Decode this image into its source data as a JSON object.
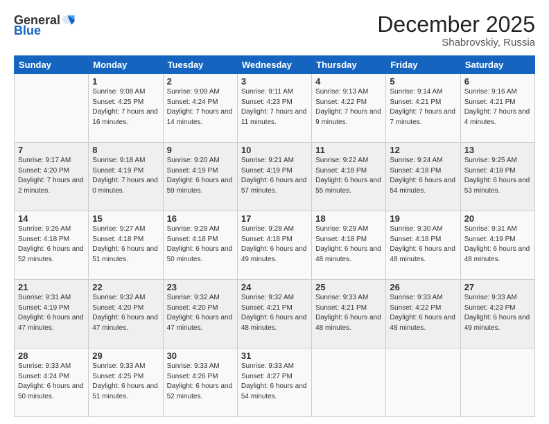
{
  "header": {
    "logo_general": "General",
    "logo_blue": "Blue",
    "month_title": "December 2025",
    "location": "Shabrovskiy, Russia"
  },
  "days_of_week": [
    "Sunday",
    "Monday",
    "Tuesday",
    "Wednesday",
    "Thursday",
    "Friday",
    "Saturday"
  ],
  "weeks": [
    [
      {
        "day": "",
        "sunrise": "",
        "sunset": "",
        "daylight": ""
      },
      {
        "day": "1",
        "sunrise": "Sunrise: 9:08 AM",
        "sunset": "Sunset: 4:25 PM",
        "daylight": "Daylight: 7 hours and 16 minutes."
      },
      {
        "day": "2",
        "sunrise": "Sunrise: 9:09 AM",
        "sunset": "Sunset: 4:24 PM",
        "daylight": "Daylight: 7 hours and 14 minutes."
      },
      {
        "day": "3",
        "sunrise": "Sunrise: 9:11 AM",
        "sunset": "Sunset: 4:23 PM",
        "daylight": "Daylight: 7 hours and 11 minutes."
      },
      {
        "day": "4",
        "sunrise": "Sunrise: 9:13 AM",
        "sunset": "Sunset: 4:22 PM",
        "daylight": "Daylight: 7 hours and 9 minutes."
      },
      {
        "day": "5",
        "sunrise": "Sunrise: 9:14 AM",
        "sunset": "Sunset: 4:21 PM",
        "daylight": "Daylight: 7 hours and 7 minutes."
      },
      {
        "day": "6",
        "sunrise": "Sunrise: 9:16 AM",
        "sunset": "Sunset: 4:21 PM",
        "daylight": "Daylight: 7 hours and 4 minutes."
      }
    ],
    [
      {
        "day": "7",
        "sunrise": "Sunrise: 9:17 AM",
        "sunset": "Sunset: 4:20 PM",
        "daylight": "Daylight: 7 hours and 2 minutes."
      },
      {
        "day": "8",
        "sunrise": "Sunrise: 9:18 AM",
        "sunset": "Sunset: 4:19 PM",
        "daylight": "Daylight: 7 hours and 0 minutes."
      },
      {
        "day": "9",
        "sunrise": "Sunrise: 9:20 AM",
        "sunset": "Sunset: 4:19 PM",
        "daylight": "Daylight: 6 hours and 59 minutes."
      },
      {
        "day": "10",
        "sunrise": "Sunrise: 9:21 AM",
        "sunset": "Sunset: 4:19 PM",
        "daylight": "Daylight: 6 hours and 57 minutes."
      },
      {
        "day": "11",
        "sunrise": "Sunrise: 9:22 AM",
        "sunset": "Sunset: 4:18 PM",
        "daylight": "Daylight: 6 hours and 55 minutes."
      },
      {
        "day": "12",
        "sunrise": "Sunrise: 9:24 AM",
        "sunset": "Sunset: 4:18 PM",
        "daylight": "Daylight: 6 hours and 54 minutes."
      },
      {
        "day": "13",
        "sunrise": "Sunrise: 9:25 AM",
        "sunset": "Sunset: 4:18 PM",
        "daylight": "Daylight: 6 hours and 53 minutes."
      }
    ],
    [
      {
        "day": "14",
        "sunrise": "Sunrise: 9:26 AM",
        "sunset": "Sunset: 4:18 PM",
        "daylight": "Daylight: 6 hours and 52 minutes."
      },
      {
        "day": "15",
        "sunrise": "Sunrise: 9:27 AM",
        "sunset": "Sunset: 4:18 PM",
        "daylight": "Daylight: 6 hours and 51 minutes."
      },
      {
        "day": "16",
        "sunrise": "Sunrise: 9:28 AM",
        "sunset": "Sunset: 4:18 PM",
        "daylight": "Daylight: 6 hours and 50 minutes."
      },
      {
        "day": "17",
        "sunrise": "Sunrise: 9:28 AM",
        "sunset": "Sunset: 4:18 PM",
        "daylight": "Daylight: 6 hours and 49 minutes."
      },
      {
        "day": "18",
        "sunrise": "Sunrise: 9:29 AM",
        "sunset": "Sunset: 4:18 PM",
        "daylight": "Daylight: 6 hours and 48 minutes."
      },
      {
        "day": "19",
        "sunrise": "Sunrise: 9:30 AM",
        "sunset": "Sunset: 4:18 PM",
        "daylight": "Daylight: 6 hours and 48 minutes."
      },
      {
        "day": "20",
        "sunrise": "Sunrise: 9:31 AM",
        "sunset": "Sunset: 4:19 PM",
        "daylight": "Daylight: 6 hours and 48 minutes."
      }
    ],
    [
      {
        "day": "21",
        "sunrise": "Sunrise: 9:31 AM",
        "sunset": "Sunset: 4:19 PM",
        "daylight": "Daylight: 6 hours and 47 minutes."
      },
      {
        "day": "22",
        "sunrise": "Sunrise: 9:32 AM",
        "sunset": "Sunset: 4:20 PM",
        "daylight": "Daylight: 6 hours and 47 minutes."
      },
      {
        "day": "23",
        "sunrise": "Sunrise: 9:32 AM",
        "sunset": "Sunset: 4:20 PM",
        "daylight": "Daylight: 6 hours and 47 minutes."
      },
      {
        "day": "24",
        "sunrise": "Sunrise: 9:32 AM",
        "sunset": "Sunset: 4:21 PM",
        "daylight": "Daylight: 6 hours and 48 minutes."
      },
      {
        "day": "25",
        "sunrise": "Sunrise: 9:33 AM",
        "sunset": "Sunset: 4:21 PM",
        "daylight": "Daylight: 6 hours and 48 minutes."
      },
      {
        "day": "26",
        "sunrise": "Sunrise: 9:33 AM",
        "sunset": "Sunset: 4:22 PM",
        "daylight": "Daylight: 6 hours and 48 minutes."
      },
      {
        "day": "27",
        "sunrise": "Sunrise: 9:33 AM",
        "sunset": "Sunset: 4:23 PM",
        "daylight": "Daylight: 6 hours and 49 minutes."
      }
    ],
    [
      {
        "day": "28",
        "sunrise": "Sunrise: 9:33 AM",
        "sunset": "Sunset: 4:24 PM",
        "daylight": "Daylight: 6 hours and 50 minutes."
      },
      {
        "day": "29",
        "sunrise": "Sunrise: 9:33 AM",
        "sunset": "Sunset: 4:25 PM",
        "daylight": "Daylight: 6 hours and 51 minutes."
      },
      {
        "day": "30",
        "sunrise": "Sunrise: 9:33 AM",
        "sunset": "Sunset: 4:26 PM",
        "daylight": "Daylight: 6 hours and 52 minutes."
      },
      {
        "day": "31",
        "sunrise": "Sunrise: 9:33 AM",
        "sunset": "Sunset: 4:27 PM",
        "daylight": "Daylight: 6 hours and 54 minutes."
      },
      {
        "day": "",
        "sunrise": "",
        "sunset": "",
        "daylight": ""
      },
      {
        "day": "",
        "sunrise": "",
        "sunset": "",
        "daylight": ""
      },
      {
        "day": "",
        "sunrise": "",
        "sunset": "",
        "daylight": ""
      }
    ]
  ]
}
